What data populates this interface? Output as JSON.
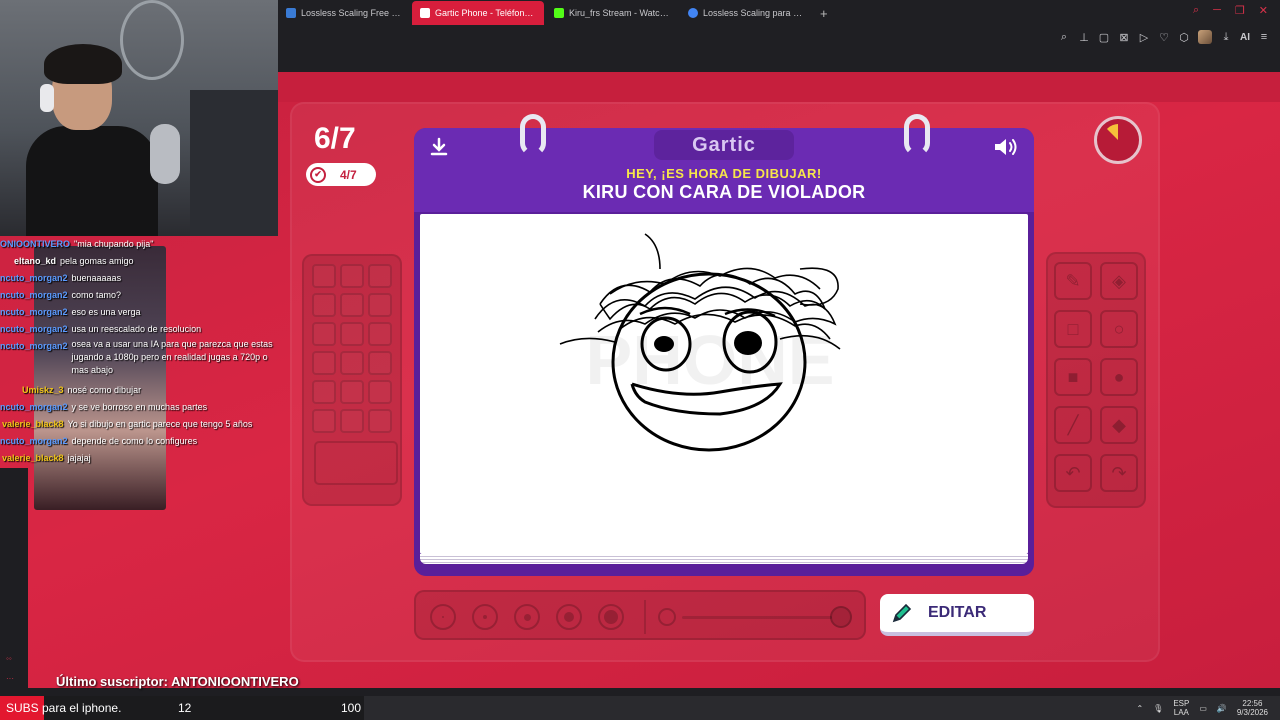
{
  "browser": {
    "tabs": [
      {
        "label": "Lossless Scaling Free Dow",
        "color": "#3a7bd5",
        "active": false
      },
      {
        "label": "Gartic Phone - Teléfono De",
        "color": "#ffffff",
        "active": true
      },
      {
        "label": "Kiru_frs Stream - Watch L",
        "color": "#53fc18",
        "active": false
      },
      {
        "label": "Lossless Scaling para q sirv",
        "color": "#4285f4",
        "active": false
      }
    ],
    "new_tab": "+",
    "ai_label": "AI"
  },
  "game": {
    "round": "6/7",
    "done_count": "4/7",
    "logo": "Gartic",
    "subtitle": "HEY, ¡ES HORA DE DIBUJAR!",
    "prompt": "KIRU CON CARA DE VIOLADOR",
    "edit_label": "EDITAR",
    "timer_fraction_remaining": 0.9,
    "accent_purple": "#6b2bb3",
    "background_red": "#d92644"
  },
  "chat": [
    {
      "user": "ONIOONTIVERO",
      "user_color": "#5b9bff",
      "msg": "\"mia chupando pija\""
    },
    {
      "user": "eltano_kd",
      "user_color": "#ffffff",
      "msg": "pela gomas amigo"
    },
    {
      "user": "ncuto_morgan2",
      "user_color": "#5b9bff",
      "msg": "buenaaaaas"
    },
    {
      "user": "ncuto_morgan2",
      "user_color": "#5b9bff",
      "msg": "como tamo?"
    },
    {
      "user": "ncuto_morgan2",
      "user_color": "#5b9bff",
      "msg": "eso es una verga"
    },
    {
      "user": "ncuto_morgan2",
      "user_color": "#5b9bff",
      "msg": "usa un reescalado de resolucion"
    },
    {
      "user": "ncuto_morgan2",
      "user_color": "#5b9bff",
      "msg": "osea va a usar una IA para que parezca que estas jugando a 1080p pero en realidad jugas a 720p o mas abajo"
    },
    {
      "user": "Umiskz_3",
      "user_color": "#f0c419",
      "msg": "nosé como dibujar"
    },
    {
      "user": "ncuto_morgan2",
      "user_color": "#5b9bff",
      "msg": "y se ve borroso en muchas partes"
    },
    {
      "user": "valerie_black8",
      "user_color": "#f0c419",
      "msg": "Yo si dibujo en gartic parece que tengo 5 años"
    },
    {
      "user": "ncuto_morgan2",
      "user_color": "#5b9bff",
      "msg": "depende de como lo configures"
    },
    {
      "user": "valerie_black8",
      "user_color": "#f0c419",
      "msg": "jajajaj"
    }
  ],
  "stream": {
    "last_subscriber": "Último suscriptor: ANTONIOONTIVERO",
    "subs_label": "SUBS para el iphone.",
    "subs_count": "12",
    "subs_goal": "100"
  },
  "tray": {
    "lang_top": "ESP",
    "lang_bottom": "LAA",
    "time": "22:56",
    "date": "9/3/2026"
  },
  "icons": {
    "download": "download-icon",
    "sound": "speaker-icon",
    "edit": "pencil-icon"
  }
}
